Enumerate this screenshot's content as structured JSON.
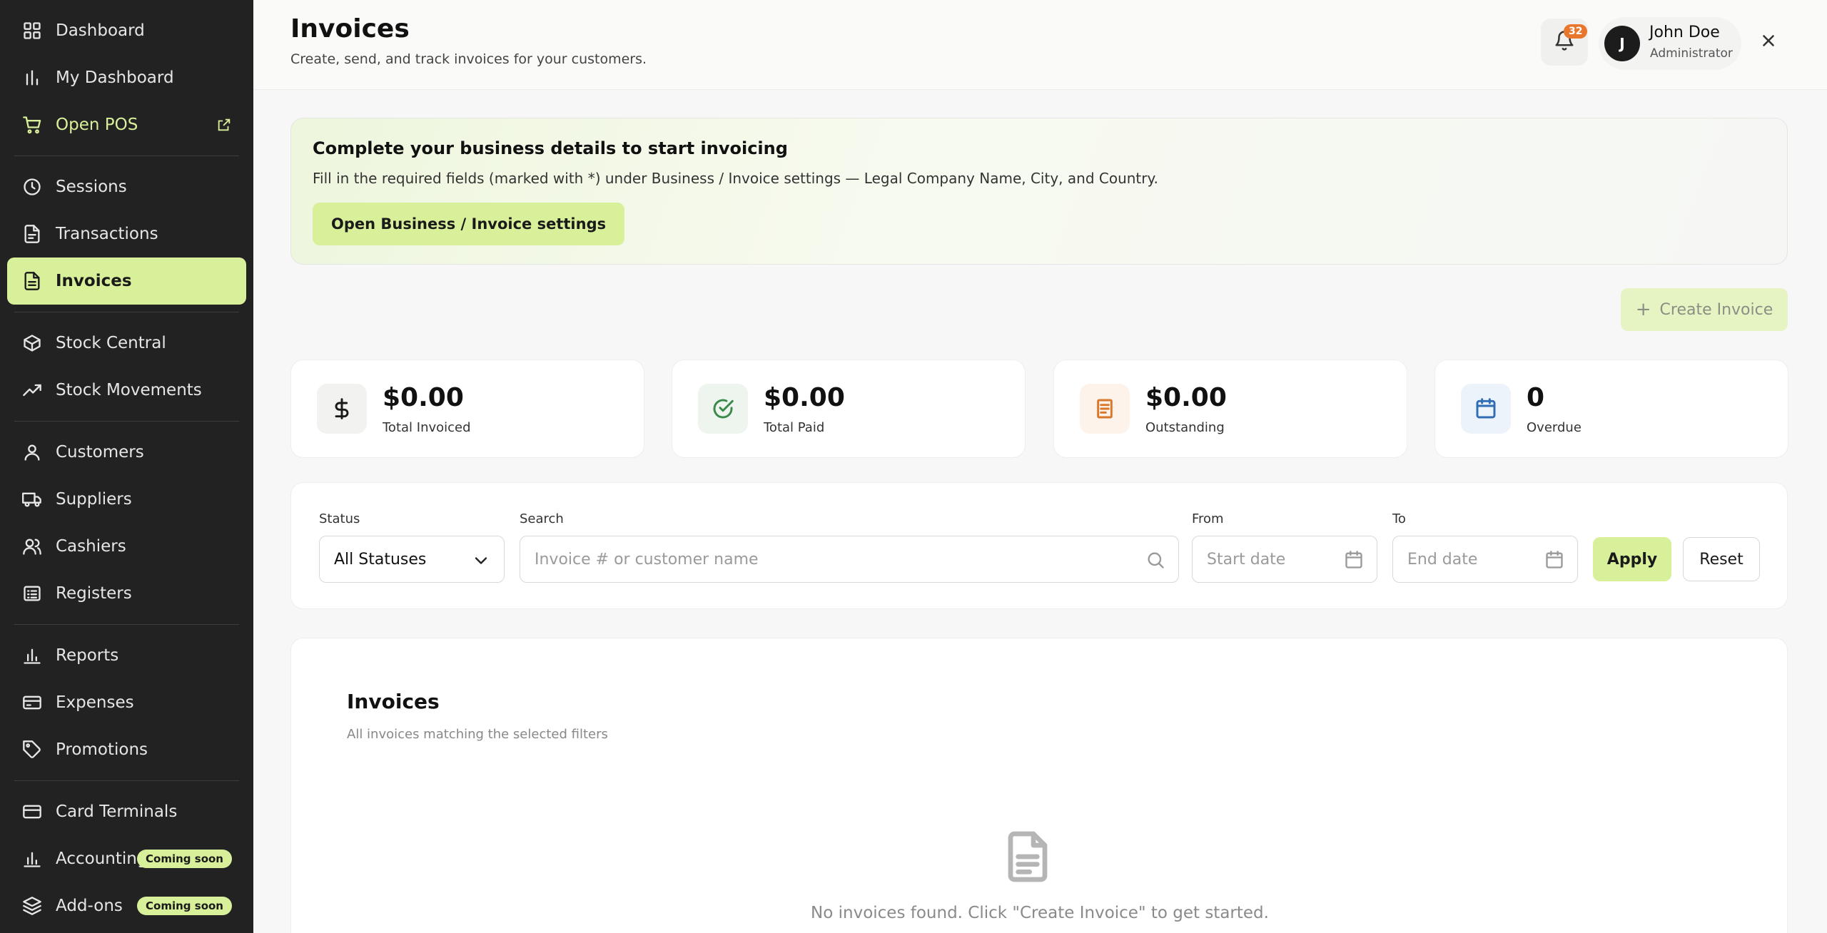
{
  "sidebar": {
    "items": [
      {
        "label": "Dashboard",
        "icon": "grid-icon"
      },
      {
        "label": "My Dashboard",
        "icon": "bar-chart-icon"
      },
      {
        "label": "Open POS",
        "icon": "cart-icon",
        "external": "external-link-icon"
      },
      {
        "label": "Sessions",
        "icon": "clock-icon"
      },
      {
        "label": "Transactions",
        "icon": "file-icon"
      },
      {
        "label": "Invoices",
        "icon": "file-text-icon"
      },
      {
        "label": "Stock Central",
        "icon": "box-icon"
      },
      {
        "label": "Stock Movements",
        "icon": "trending-up-icon"
      },
      {
        "label": "Customers",
        "icon": "user-icon"
      },
      {
        "label": "Suppliers",
        "icon": "truck-icon"
      },
      {
        "label": "Cashiers",
        "icon": "users-icon"
      },
      {
        "label": "Registers",
        "icon": "list-icon"
      },
      {
        "label": "Reports",
        "icon": "bar-chart-icon"
      },
      {
        "label": "Expenses",
        "icon": "wallet-icon"
      },
      {
        "label": "Promotions",
        "icon": "tag-icon"
      },
      {
        "label": "Card Terminals",
        "icon": "credit-card-icon"
      },
      {
        "label": "Accounting",
        "icon": "bar-chart-icon",
        "badge": "Coming soon"
      },
      {
        "label": "Add-ons",
        "icon": "layers-icon",
        "badge": "Coming soon"
      }
    ],
    "active": "Invoices"
  },
  "header": {
    "title": "Invoices",
    "subtitle": "Create, send, and track invoices for your customers.",
    "notification_count": "32",
    "user": {
      "initial": "J",
      "name": "John Doe",
      "role": "Administrator"
    }
  },
  "banner": {
    "title": "Complete your business details to start invoicing",
    "text": "Fill in the required fields (marked with *) under Business / Invoice settings — Legal Company Name, City, and Country.",
    "button": "Open Business / Invoice settings"
  },
  "create_button": "Create Invoice",
  "stats": [
    {
      "value": "$0.00",
      "label": "Total Invoiced",
      "icon": "dollar-icon",
      "color": "#1a1a1a",
      "bg": "#f2f2f0"
    },
    {
      "value": "$0.00",
      "label": "Total Paid",
      "icon": "check-circle-icon",
      "color": "#3a8a4a",
      "bg": "#eef5ee"
    },
    {
      "value": "$0.00",
      "label": "Outstanding",
      "icon": "receipt-icon",
      "color": "#d9772b",
      "bg": "#fdf3ea"
    },
    {
      "value": "0",
      "label": "Overdue",
      "icon": "calendar-icon",
      "color": "#2f6db5",
      "bg": "#edf3fa"
    }
  ],
  "filters": {
    "status_label": "Status",
    "status_value": "All Statuses",
    "search_label": "Search",
    "search_placeholder": "Invoice # or customer name",
    "from_label": "From",
    "from_placeholder": "Start date",
    "to_label": "To",
    "to_placeholder": "End date",
    "apply": "Apply",
    "reset": "Reset"
  },
  "invoices_panel": {
    "title": "Invoices",
    "subtitle": "All invoices matching the selected filters",
    "empty_text": "No invoices found. Click \"Create Invoice\" to get started."
  }
}
